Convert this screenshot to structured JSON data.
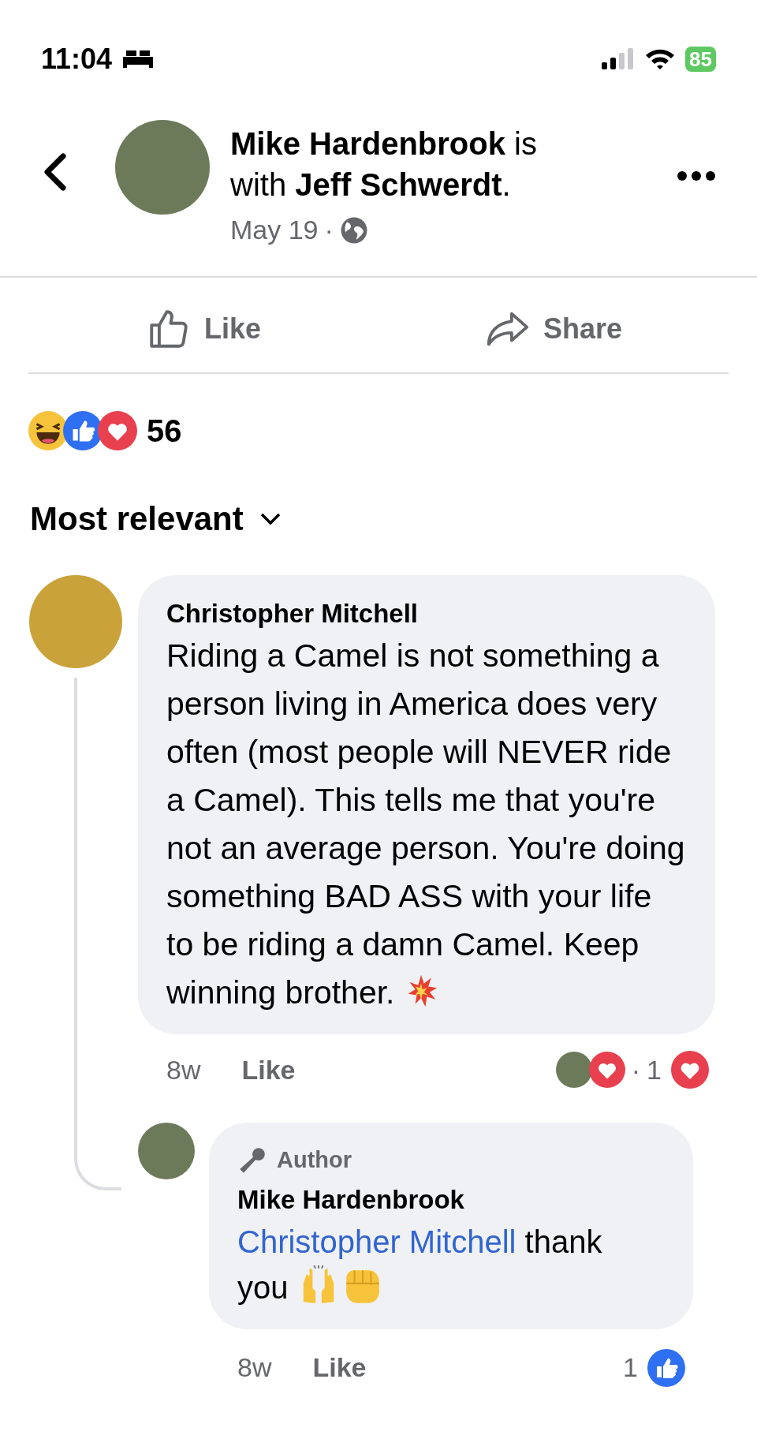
{
  "status_bar": {
    "time": "11:04",
    "battery": "85"
  },
  "post_header": {
    "title": "**Mike Hardenbrook** is with **Jeff Schwerdt**.",
    "date": "May 19",
    "separator": "·"
  },
  "actions": [
    {
      "kind": "like",
      "label": "Like"
    },
    {
      "kind": "share",
      "label": "Share"
    }
  ],
  "reactions": {
    "count": "56"
  },
  "sort": {
    "label": "Most relevant"
  },
  "comments": [
    {
      "name": "Christopher Mitchell",
      "text": "Riding a Camel is not something a person living in America does very often (most people will NEVER ride a Camel). This tells me that you're not an average person. You're doing something BAD ASS with your life to be riding a damn Camel. Keep winning brother.",
      "time": "8w",
      "like": "Like",
      "separator": "·",
      "reaction_count": "1",
      "replies": [
        {
          "badge": "Author",
          "name": "Mike Hardenbrook",
          "mention": "Christopher Mitchell",
          "text": "thank you",
          "time": "8w",
          "like": "Like",
          "reaction_count": "1"
        }
      ]
    }
  ]
}
